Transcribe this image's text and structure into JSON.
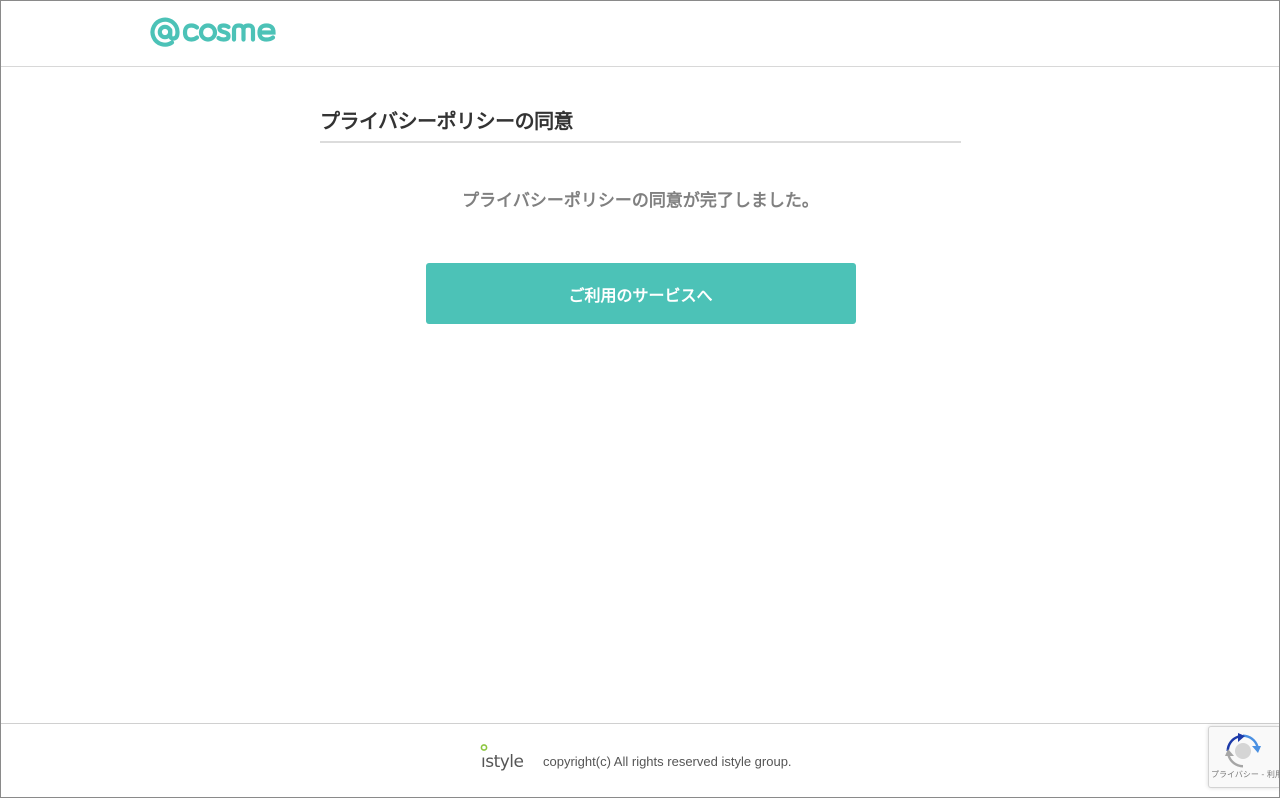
{
  "header": {
    "logo_text": "@cosme"
  },
  "main": {
    "title": "プライバシーポリシーの同意",
    "message": "プライバシーポリシーの同意が完了しました。",
    "cta_label": "ご利用のサービスへ"
  },
  "footer": {
    "brand": "istyle",
    "copyright": "copyright(c) All rights reserved istyle group."
  },
  "recaptcha": {
    "privacy_label": "プライバシー",
    "separator": " - ",
    "terms_label": "利用規約"
  },
  "colors": {
    "brand_teal": "#4cc2b7",
    "istyle_green": "#8cc63f",
    "title_text": "#333333",
    "message_text": "#808080"
  }
}
